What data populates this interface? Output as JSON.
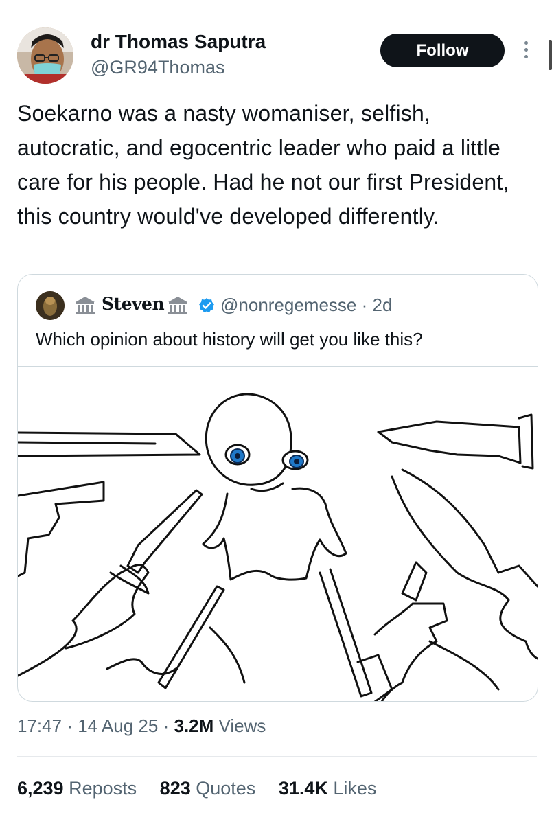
{
  "author": {
    "name": "dr Thomas Saputra",
    "handle": "@GR94Thomas",
    "follow_label": "Follow"
  },
  "tweet": {
    "text": "Soekarno was a nasty womaniser, selfish, autocratic, and egocentric leader who paid a little care for his people. Had he not our first President, this country would've developed differently."
  },
  "quoted_tweet": {
    "name": "Steven",
    "handle": "@nonregemesse",
    "separator": "·",
    "age": "2d",
    "text": "Which opinion about history will get you like this?",
    "image_description_icon": "stickman-surrounded-by-knives-drawing",
    "verified_color": "#1d9bf0"
  },
  "meta": {
    "time": "17:47",
    "date": "14 Aug 25",
    "views_count": "3.2M",
    "views_label": "Views",
    "separator": "·"
  },
  "stats": {
    "reposts_count": "6,239",
    "reposts_label": "Reposts",
    "quotes_count": "823",
    "quotes_label": "Quotes",
    "likes_count": "31.4K",
    "likes_label": "Likes"
  },
  "colors": {
    "text_primary": "#0f1419",
    "text_secondary": "#536471",
    "button_bg": "#0f1419",
    "border": "#cfd9de",
    "verified": "#1d9bf0",
    "eye_blue": "#1f78c8"
  }
}
